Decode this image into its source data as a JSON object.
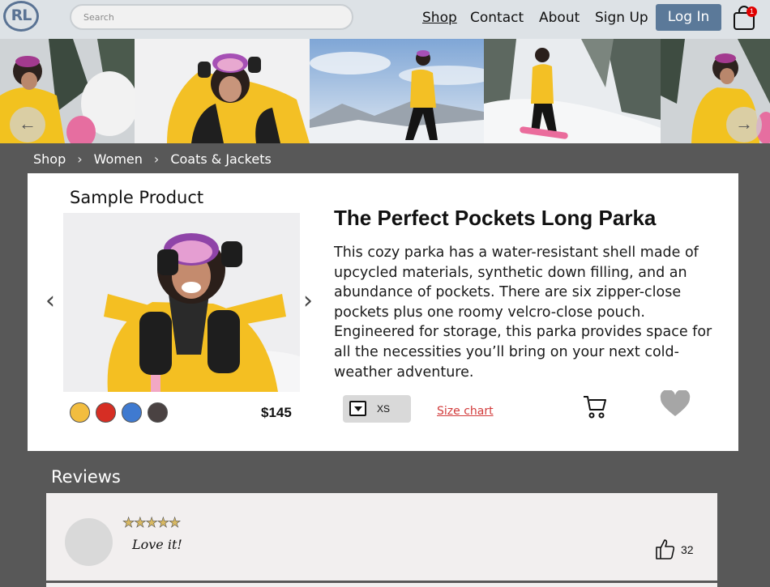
{
  "header": {
    "logo_text": "RL",
    "search_placeholder": "Search",
    "nav": [
      "Shop",
      "Contact",
      "About",
      "Sign Up"
    ],
    "login_label": "Log In",
    "cart_badge": "1"
  },
  "hero": {
    "prev_icon": "arrow-left-icon",
    "next_icon": "arrow-right-icon"
  },
  "breadcrumb": [
    "Shop",
    "Women",
    "Coats & Jackets"
  ],
  "product": {
    "section_label": "Sample Product",
    "title": "The Perfect Pockets Long Parka",
    "description": "This cozy parka has a water-resistant shell made of upcycled materials, synthetic down filling, and an abundance of pockets. There are six zipper-close pockets plus one roomy velcro-close pouch. Engineered for storage, this parka provides space for all the necessities you’ll bring on your next cold-weather adventure.",
    "price": "$145",
    "colors": [
      "#f2bd3f",
      "#d62e24",
      "#3f7ad0",
      "#4a4242"
    ],
    "size": "XS",
    "size_chart_label": "Size chart"
  },
  "reviews": {
    "title": "Reviews",
    "items": [
      {
        "rating": 5,
        "stars": "★★★★★",
        "text": "Love it!",
        "likes": "32"
      }
    ]
  }
}
